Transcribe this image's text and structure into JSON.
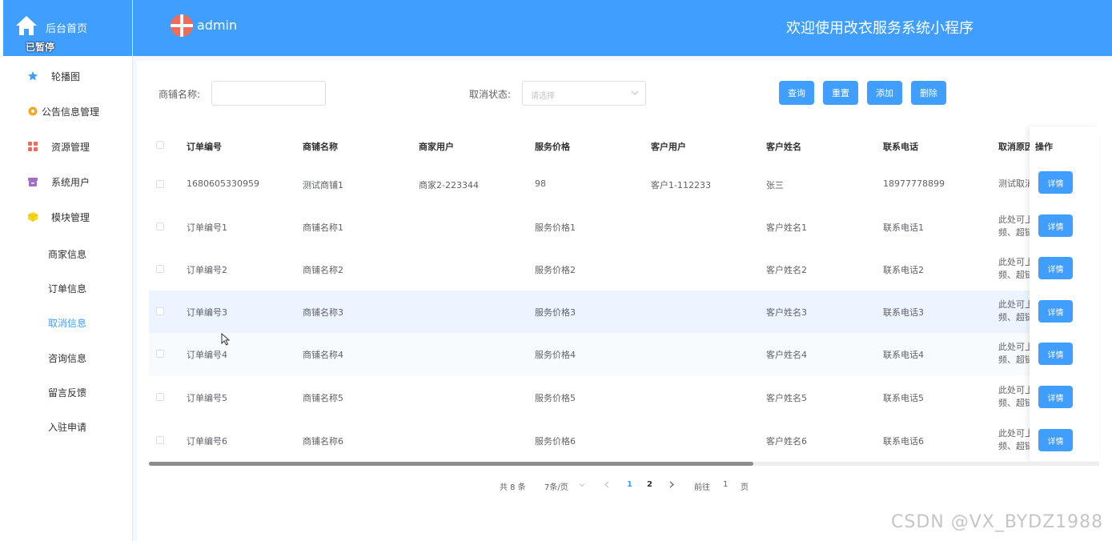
{
  "sidebar": {
    "home_label": "后台首页",
    "paused_badge": "已暂停",
    "menu": [
      {
        "label": "轮播图",
        "icon": "star-icon",
        "color": "#409eff"
      },
      {
        "label": "公告信息管理",
        "icon": "gear-icon",
        "color": "#f5a623"
      },
      {
        "label": "资源管理",
        "icon": "grid-icon",
        "color": "#f06c5a"
      },
      {
        "label": "系统用户",
        "icon": "archive-icon",
        "color": "#a56cc1"
      },
      {
        "label": "模块管理",
        "icon": "cube-icon",
        "color": "#f8d81f"
      }
    ],
    "sub_items": [
      "商家信息",
      "订单信息",
      "取消信息",
      "咨询信息",
      "留言反馈",
      "入驻申请"
    ],
    "active_sub": "取消信息"
  },
  "header": {
    "user": "admin",
    "title": "欢迎使用改衣服务系统小程序",
    "accent": "#409eff"
  },
  "search": {
    "shop_label": "商铺名称:",
    "shop_value": "",
    "status_label": "取消状态:",
    "status_placeholder": "请选择",
    "buttons": [
      "查询",
      "重置",
      "添加",
      "删除"
    ]
  },
  "table": {
    "columns": [
      "订单编号",
      "商铺名称",
      "商家用户",
      "服务价格",
      "客户用户",
      "客户姓名",
      "联系电话",
      "取消原因",
      "操作"
    ],
    "rows": [
      {
        "order": "1680605330959",
        "shop": "测试商铺1",
        "merchant": "商家2-223344",
        "price": "98",
        "customer": "客户1-112233",
        "name": "张三",
        "phone": "18977778899",
        "reason1": "测试取消",
        "reason2": ""
      },
      {
        "order": "订单编号1",
        "shop": "商铺名称1",
        "merchant": "",
        "price": "服务价格1",
        "customer": "",
        "name": "客户姓名1",
        "phone": "联系电话1",
        "reason1": "此处可上",
        "reason2": "频、超链"
      },
      {
        "order": "订单编号2",
        "shop": "商铺名称2",
        "merchant": "",
        "price": "服务价格2",
        "customer": "",
        "name": "客户姓名2",
        "phone": "联系电话2",
        "reason1": "此处可上",
        "reason2": "频、超链"
      },
      {
        "order": "订单编号3",
        "shop": "商铺名称3",
        "merchant": "",
        "price": "服务价格3",
        "customer": "",
        "name": "客户姓名3",
        "phone": "联系电话3",
        "reason1": "此处可上",
        "reason2": "频、超链"
      },
      {
        "order": "订单编号4",
        "shop": "商铺名称4",
        "merchant": "",
        "price": "服务价格4",
        "customer": "",
        "name": "客户姓名4",
        "phone": "联系电话4",
        "reason1": "此处可上",
        "reason2": "频、超链"
      },
      {
        "order": "订单编号5",
        "shop": "商铺名称5",
        "merchant": "",
        "price": "服务价格5",
        "customer": "",
        "name": "客户姓名5",
        "phone": "联系电话5",
        "reason1": "此处可上",
        "reason2": "频、超链"
      },
      {
        "order": "订单编号6",
        "shop": "商铺名称6",
        "merchant": "",
        "price": "服务价格6",
        "customer": "",
        "name": "客户姓名6",
        "phone": "联系电话6",
        "reason1": "此处可上",
        "reason2": "频、超链"
      }
    ],
    "detail_label": "详情"
  },
  "pagination": {
    "total": "共 8 条",
    "page_size": "7条/页",
    "pages": [
      "1",
      "2"
    ],
    "current": "1",
    "goto_prefix": "前往",
    "goto_value": "1",
    "goto_suffix": "页"
  },
  "watermark": "CSDN @VX_BYDZ1988"
}
